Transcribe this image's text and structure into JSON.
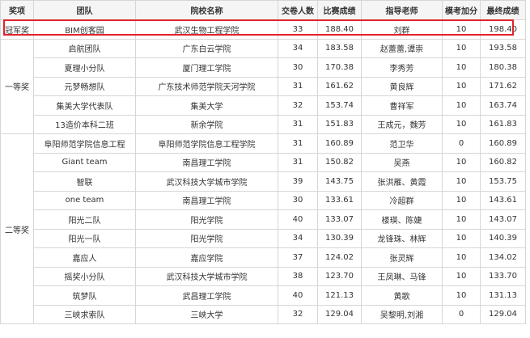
{
  "columns": [
    "奖项",
    "团队",
    "院校名称",
    "交卷人数",
    "比赛成绩",
    "指导老师",
    "模考加分",
    "最终成绩"
  ],
  "awards": {
    "champion": "冠军奖",
    "first": "一等奖",
    "second": "二等奖"
  },
  "highlight_color": "#e0232b",
  "rows": [
    {
      "award": "champion",
      "team": "BIM创客园",
      "school": "武汉生物工程学院",
      "count": "33",
      "score": "188.40",
      "teacher": "刘群",
      "bonus": "10",
      "final": "198.40"
    },
    {
      "award": "first",
      "team": "启航团队",
      "school": "广东白云学院",
      "count": "34",
      "score": "183.58",
      "teacher": "赵蕾蕾,谭崇",
      "bonus": "10",
      "final": "193.58"
    },
    {
      "award": "first",
      "team": "夏理小分队",
      "school": "厦门理工学院",
      "count": "30",
      "score": "170.38",
      "teacher": "李秀芳",
      "bonus": "10",
      "final": "180.38"
    },
    {
      "award": "first",
      "team": "元梦畅想队",
      "school": "广东技术师范学院天河学院",
      "count": "31",
      "score": "161.62",
      "teacher": "黄良辉",
      "bonus": "10",
      "final": "171.62"
    },
    {
      "award": "first",
      "team": "集美大学代表队",
      "school": "集美大学",
      "count": "32",
      "score": "153.74",
      "teacher": "曹祥军",
      "bonus": "10",
      "final": "163.74"
    },
    {
      "award": "first",
      "team": "13造价本科二班",
      "school": "新余学院",
      "count": "31",
      "score": "151.83",
      "teacher": "王成元，魏芳",
      "bonus": "10",
      "final": "161.83"
    },
    {
      "award": "second",
      "team": "阜阳师范学院信息工程",
      "school": "阜阳师范学院信息工程学院",
      "count": "31",
      "score": "160.89",
      "teacher": "范卫华",
      "bonus": "0",
      "final": "160.89"
    },
    {
      "award": "second",
      "team": "Giant team",
      "school": "南昌理工学院",
      "count": "31",
      "score": "150.82",
      "teacher": "吴燕",
      "bonus": "10",
      "final": "160.82"
    },
    {
      "award": "second",
      "team": "智联",
      "school": "武汉科技大学城市学院",
      "count": "39",
      "score": "143.75",
      "teacher": "张洪雁、黄霞",
      "bonus": "10",
      "final": "153.75"
    },
    {
      "award": "second",
      "team": "one team",
      "school": "南昌理工学院",
      "count": "30",
      "score": "133.61",
      "teacher": "冷超群",
      "bonus": "10",
      "final": "143.61"
    },
    {
      "award": "second",
      "team": "阳光二队",
      "school": "阳光学院",
      "count": "40",
      "score": "133.07",
      "teacher": "楼瑛、陈婕",
      "bonus": "10",
      "final": "143.07"
    },
    {
      "award": "second",
      "team": "阳光一队",
      "school": "阳光学院",
      "count": "34",
      "score": "130.39",
      "teacher": "龙锋珠、林辉",
      "bonus": "10",
      "final": "140.39"
    },
    {
      "award": "second",
      "team": "嘉应人",
      "school": "嘉应学院",
      "count": "37",
      "score": "124.02",
      "teacher": "张灵辉",
      "bonus": "10",
      "final": "134.02"
    },
    {
      "award": "second",
      "team": "摇奖小分队",
      "school": "武汉科技大学城市学院",
      "count": "38",
      "score": "123.70",
      "teacher": "王凤琳、马锋",
      "bonus": "10",
      "final": "133.70"
    },
    {
      "award": "second",
      "team": "筑梦队",
      "school": "武昌理工学院",
      "count": "40",
      "score": "121.13",
      "teacher": "黄歌",
      "bonus": "10",
      "final": "131.13"
    },
    {
      "award": "second",
      "team": "三峡求索队",
      "school": "三峡大学",
      "count": "32",
      "score": "129.04",
      "teacher": "吴黎明,刘湘",
      "bonus": "0",
      "final": "129.04"
    }
  ]
}
